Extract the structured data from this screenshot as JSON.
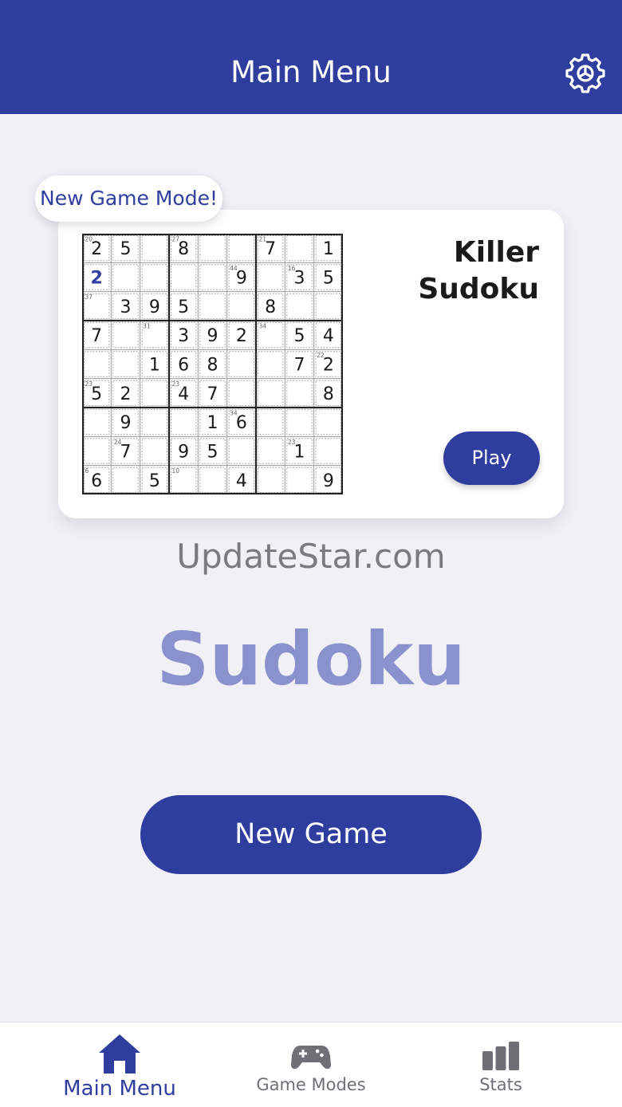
{
  "header": {
    "title": "Main Menu",
    "settings_icon": "gear-icon"
  },
  "feature_card": {
    "badge": "New Game Mode!",
    "title_line1": "Killer",
    "title_line2": "Sudoku",
    "play_label": "Play",
    "puzzle_rows": [
      [
        "2",
        "5",
        "",
        "8",
        "",
        "",
        "7",
        "",
        "1"
      ],
      [
        "2",
        "",
        "",
        "",
        "",
        "9",
        "",
        "3",
        "5"
      ],
      [
        "",
        "3",
        "9",
        "5",
        "",
        "",
        "8",
        "",
        ""
      ],
      [
        "7",
        "",
        "",
        "3",
        "9",
        "2",
        "",
        "5",
        "4"
      ],
      [
        "",
        "",
        "1",
        "6",
        "8",
        "",
        "",
        "7",
        "2"
      ],
      [
        "5",
        "2",
        "",
        "4",
        "7",
        "",
        "",
        "",
        "8"
      ],
      [
        "",
        "9",
        "",
        "",
        "1",
        "6",
        "",
        "",
        ""
      ],
      [
        "",
        "7",
        "",
        "9",
        "5",
        "",
        "",
        "1",
        ""
      ],
      [
        "6",
        "",
        "5",
        "",
        "",
        "4",
        "",
        "",
        "9"
      ]
    ],
    "highlighted_cells": [
      "1-0"
    ],
    "cage_sums": {
      "0-0": "20",
      "0-3": "27",
      "0-6": "21",
      "1-5": "44",
      "1-7": "16",
      "2-0": "37",
      "3-2": "31",
      "3-6": "34",
      "4-8": "22",
      "5-0": "23",
      "5-3": "23",
      "6-5": "34",
      "7-1": "24",
      "7-7": "23",
      "8-0": "6",
      "8-3": "10"
    }
  },
  "watermark": "UpdateStar.com",
  "app_title": "Sudoku",
  "new_game_label": "New Game",
  "tabs": [
    {
      "label": "Main Menu",
      "icon": "home-icon",
      "active": true
    },
    {
      "label": "Game Modes",
      "icon": "gamepad-icon",
      "active": false
    },
    {
      "label": "Stats",
      "icon": "bar-chart-icon",
      "active": false
    }
  ],
  "colors": {
    "primary": "#2f3d9f",
    "title_light": "#8a92cd",
    "background": "#f0f0f6",
    "inactive_tab": "#6f6f75"
  }
}
